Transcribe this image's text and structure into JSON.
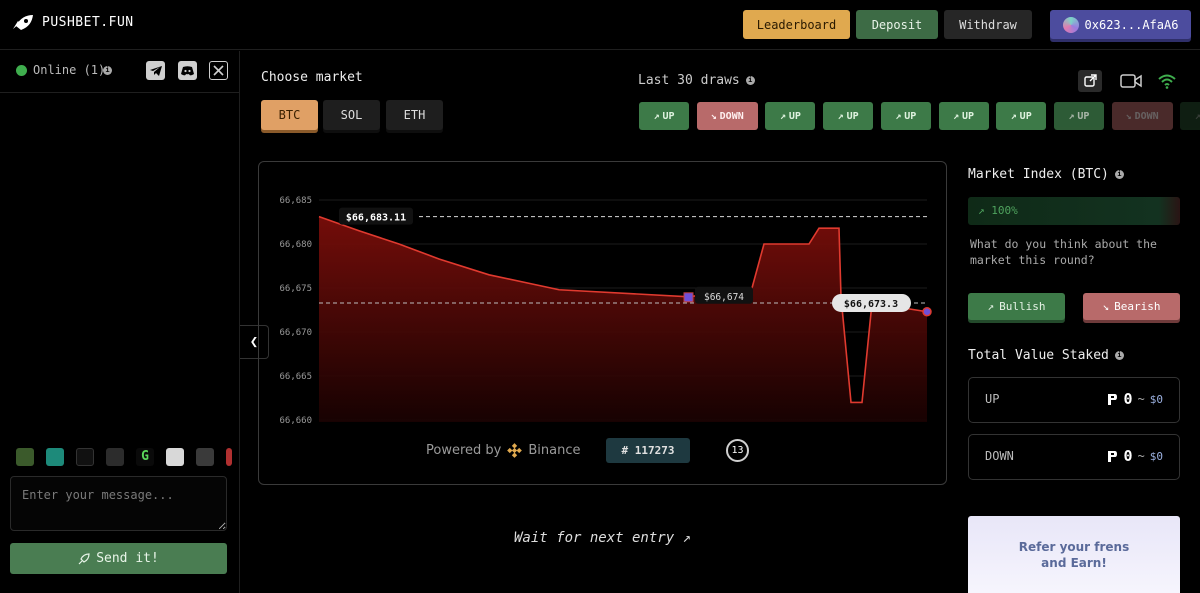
{
  "header": {
    "logo_text": "PUSHBET.FUN",
    "leaderboard_label": "Leaderboard",
    "deposit_label": "Deposit",
    "withdraw_label": "Withdraw",
    "wallet_label": "0x623...AfaA6"
  },
  "sidebar": {
    "online_text": "Online (1)",
    "chat_placeholder": "Enter your message...",
    "send_label": "Send it!"
  },
  "market": {
    "choose_label": "Choose market",
    "options": [
      "BTC",
      "SOL",
      "ETH"
    ],
    "selected": "BTC"
  },
  "draws": {
    "label": "Last 30 draws",
    "items": [
      {
        "dir": "UP",
        "label": "UP"
      },
      {
        "dir": "DOWN",
        "label": "DOWN"
      },
      {
        "dir": "UP",
        "label": "UP"
      },
      {
        "dir": "UP",
        "label": "UP"
      },
      {
        "dir": "UP",
        "label": "UP"
      },
      {
        "dir": "UP",
        "label": "UP"
      },
      {
        "dir": "UP",
        "label": "UP"
      },
      {
        "dir": "UP",
        "label": "UP"
      },
      {
        "dir": "DOWN",
        "label": "DOWN"
      },
      {
        "dir": "UP",
        "label": "UP"
      }
    ]
  },
  "chart": {
    "powered_by": "Powered by",
    "provider": "Binance",
    "round_id": "# 117273",
    "countdown": "13",
    "start_price_label": "$66,683.11",
    "mid_price_label": "$66,674",
    "current_price_label": "$66,673.3"
  },
  "chart_data": {
    "type": "area",
    "x": [
      0,
      1,
      2,
      3,
      4,
      5,
      6,
      7,
      8,
      9,
      10,
      11,
      12,
      13,
      14,
      15,
      16,
      17
    ],
    "values": [
      66683.11,
      66681.5,
      66680,
      66678.3,
      66676.5,
      66674.8,
      66674,
      66675,
      66680,
      66680,
      66680,
      66681.8,
      66681.8,
      66674,
      66662,
      66662,
      66673.3,
      66672.3
    ],
    "yticks": [
      "66,685",
      "66,680",
      "66,675",
      "66,670",
      "66,665",
      "66,660"
    ],
    "ylim": [
      66660,
      66687
    ],
    "reference_lines": [
      66683.11,
      66673.3
    ],
    "color": "#e03a2f"
  },
  "wait_text": "Wait for next entry",
  "market_index": {
    "label": "Market Index (BTC)",
    "percent_label": "100%",
    "bullish_fraction": 1.0,
    "question": "What do you think about the market this round?",
    "bullish_label": "Bullish",
    "bearish_label": "Bearish"
  },
  "staked": {
    "label": "Total Value Staked",
    "up_label": "UP",
    "up_amount": "0",
    "up_usd": "$0",
    "down_label": "DOWN",
    "down_amount": "0",
    "down_usd": "$0",
    "tilde": "~"
  },
  "refer_text": "Refer your frens and Earn!",
  "colors": {
    "up": "#3d7a48",
    "down": "#b86a6a",
    "accent": "#e0a94f",
    "wallet": "#4c4c9e",
    "chart_line": "#e03a2f"
  }
}
